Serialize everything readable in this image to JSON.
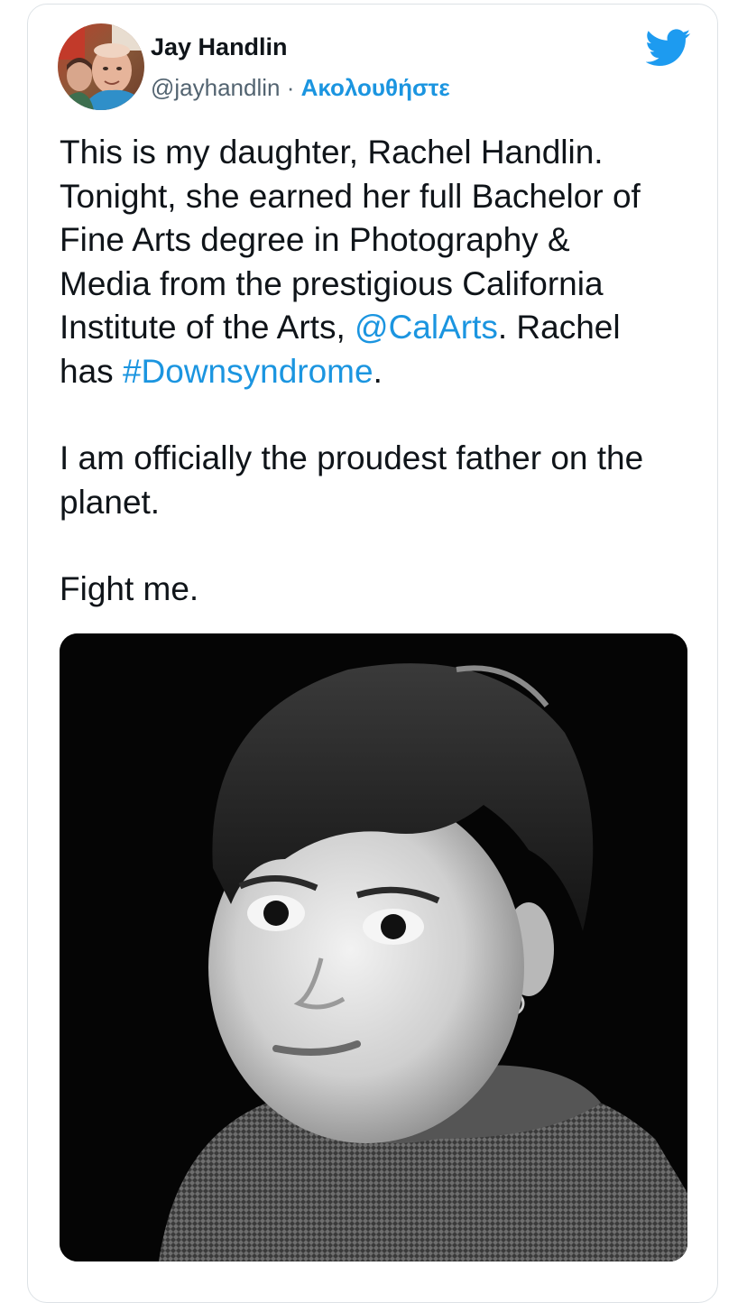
{
  "author": {
    "name": "Jay Handlin",
    "handle": "@jayhandlin",
    "separator": " · ",
    "follow_label": "Ακολουθήστε"
  },
  "tweet": {
    "line1": "This is my daughter, Rachel Handlin.",
    "line2": "Tonight, she earned her full Bachelor of",
    "line3": "Fine Arts degree in Photography &",
    "line4": "Media from the prestigious California",
    "line5_before": "Institute of the Arts, ",
    "mention": "@CalArts",
    "line5_after": ". Rachel",
    "line6_before": "has ",
    "hashtag": "#Downsyndrome",
    "line6_after": ".",
    "para2_line1": "I am officially the proudest father on the",
    "para2_line2": "planet.",
    "para3": "Fight me."
  },
  "colors": {
    "link": "#1b95e0",
    "text": "#0f1419",
    "meta": "#536471",
    "border": "#dde2e6"
  },
  "icons": {
    "brand": "twitter-bird-icon"
  }
}
